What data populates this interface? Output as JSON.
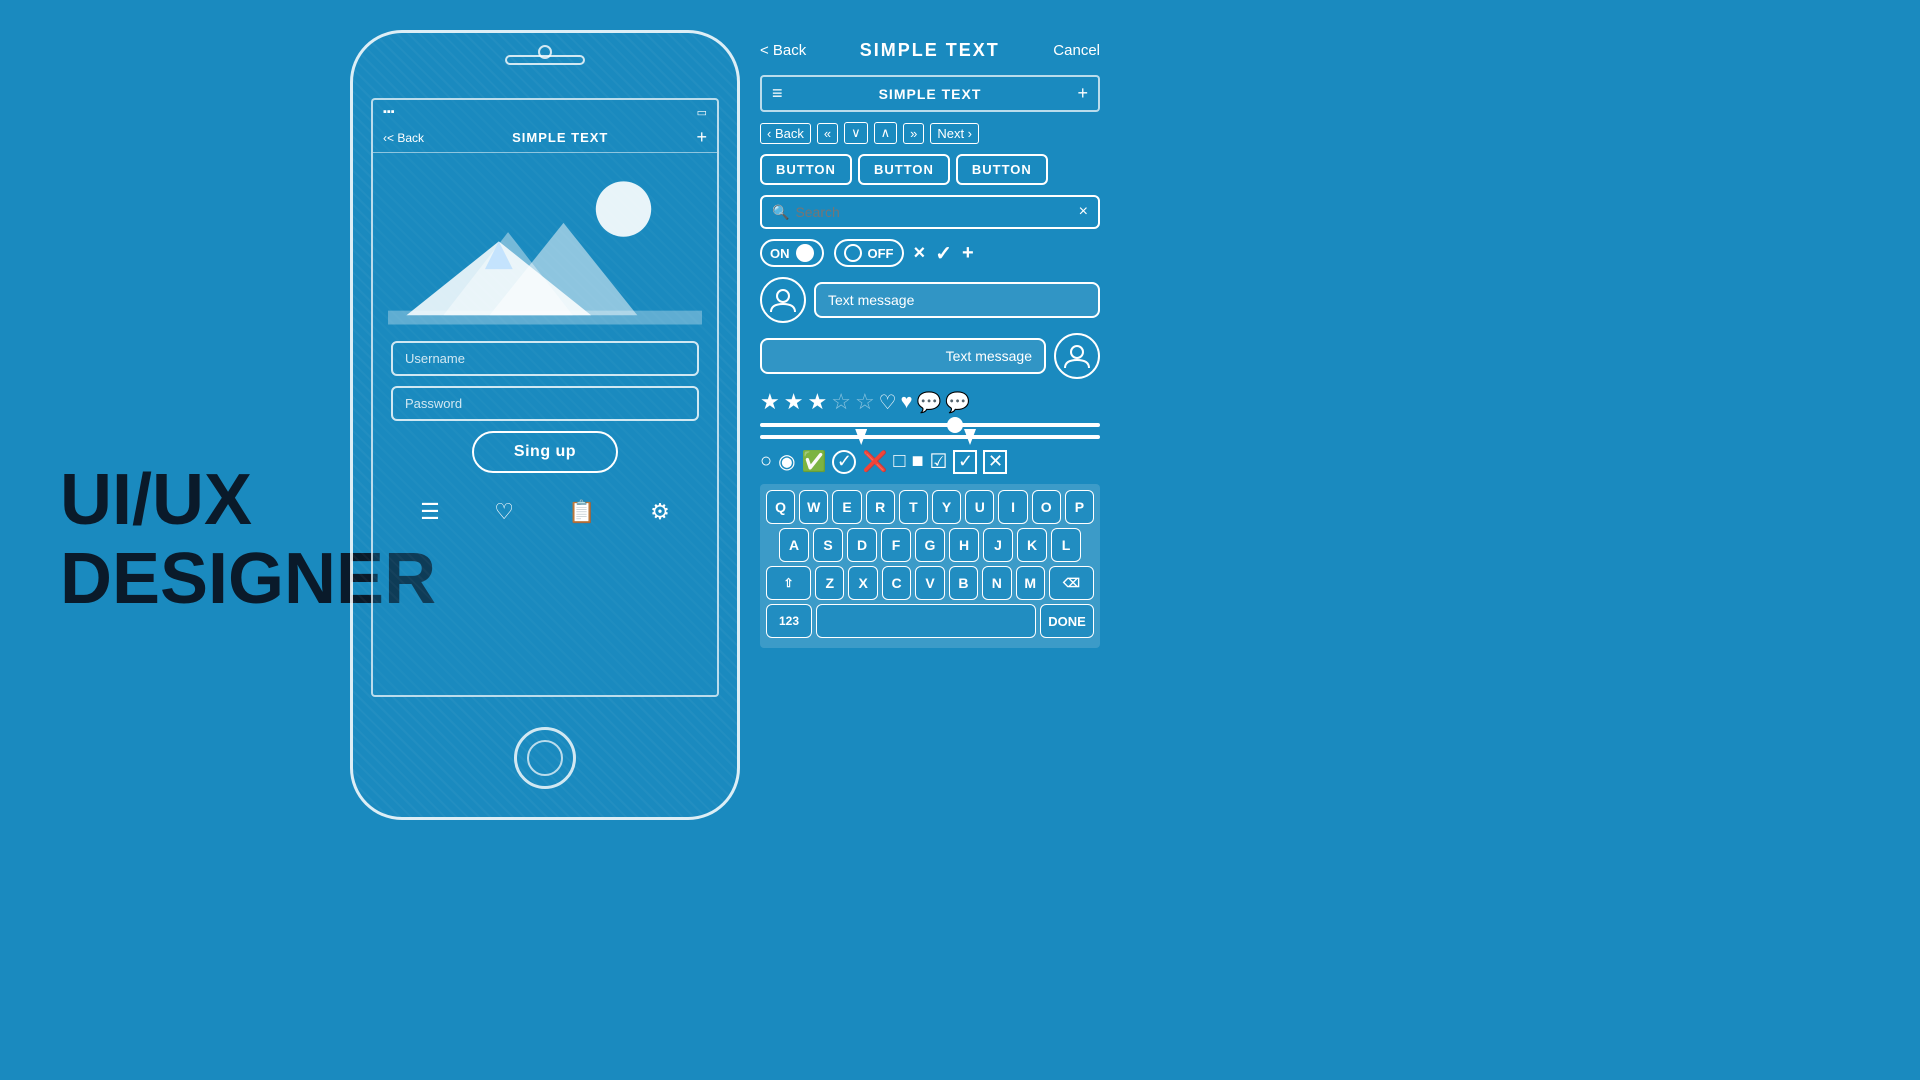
{
  "background_color": "#1a8abf",
  "title": {
    "line1": "UI/UX",
    "line2": "DESIGNER"
  },
  "phone": {
    "nav_back": "< Back",
    "nav_title": "SIMPLE TEXT",
    "nav_plus": "+",
    "username_placeholder": "Username",
    "password_placeholder": "Password",
    "signup_button": "Sing up",
    "bottom_icons": [
      "≡",
      "♡",
      "≡+",
      "⚙"
    ]
  },
  "ui_panel": {
    "topbar_back": "< Back",
    "topbar_title": "SIMPLE TEXT",
    "topbar_cancel": "Cancel",
    "navbar2_menu": "≡",
    "navbar2_title": "SIMPLE TEXT",
    "navbar2_plus": "+",
    "nav_buttons": [
      "< Back",
      "«",
      "∨",
      "∧",
      "»",
      "Next",
      ">"
    ],
    "action_buttons": [
      "BUTTON",
      "BUTTON",
      "BUTTON"
    ],
    "search_placeholder": "Search",
    "search_clear": "×",
    "toggle_on_label": "ON",
    "toggle_off_label": "OFF",
    "extra_icons": [
      "×",
      "✓",
      "+"
    ],
    "msg_left": "Text message",
    "msg_right": "Text message",
    "keyboard": {
      "row1": [
        "Q",
        "W",
        "E",
        "R",
        "T",
        "Y",
        "U",
        "I",
        "O",
        "P"
      ],
      "row2": [
        "A",
        "S",
        "D",
        "F",
        "G",
        "H",
        "J",
        "K",
        "L"
      ],
      "row3": [
        "⇧",
        "Z",
        "X",
        "C",
        "V",
        "B",
        "N",
        "M",
        "⌫"
      ],
      "row4_left": "123",
      "row4_done": "DONE"
    }
  }
}
